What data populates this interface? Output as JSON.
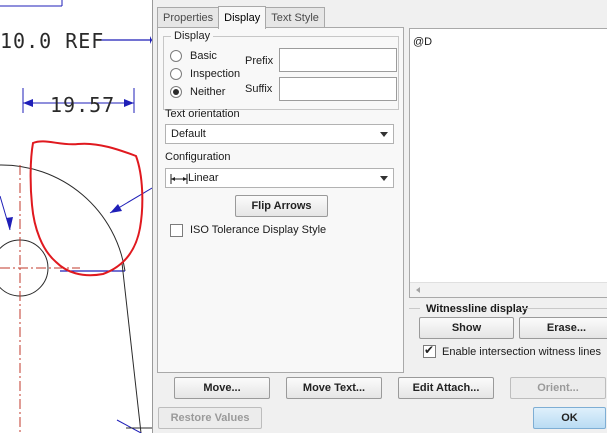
{
  "drawing": {
    "ref_dimension": "10.0 REF",
    "dimension_value": "19.57"
  },
  "dialog": {
    "tabs": [
      {
        "label": "Properties",
        "active": false
      },
      {
        "label": "Display",
        "active": true
      },
      {
        "label": "Text Style",
        "active": false
      }
    ],
    "display_group": {
      "legend": "Display",
      "options": [
        {
          "label": "Basic",
          "checked": false
        },
        {
          "label": "Inspection",
          "checked": false
        },
        {
          "label": "Neither",
          "checked": true
        }
      ],
      "prefix_label": "Prefix",
      "prefix_value": "",
      "suffix_label": "Suffix",
      "suffix_value": ""
    },
    "text_orientation": {
      "label": "Text orientation",
      "selected": "Default"
    },
    "configuration": {
      "label": "Configuration",
      "selected": "Linear"
    },
    "flip_arrows_label": "Flip Arrows",
    "iso_tolerance": {
      "label": "ISO Tolerance Display Style",
      "checked": false
    },
    "text_content": "@D",
    "witnessline": {
      "legend": "Witnessline display",
      "show_label": "Show",
      "erase_label": "Erase...",
      "enable_label": "Enable intersection witness lines",
      "enable_checked": true
    },
    "buttons": {
      "move": "Move...",
      "move_text": "Move Text...",
      "edit_attach": "Edit Attach...",
      "orient": "Orient...",
      "restore": "Restore Values",
      "ok": "OK"
    }
  },
  "colors": {
    "drawing_line": "#1f1fb8",
    "center_line": "#c0392b",
    "markup": "#e0191f",
    "dialog_bg": "#f0f0f0",
    "ok_button": "#c9e5f7"
  }
}
